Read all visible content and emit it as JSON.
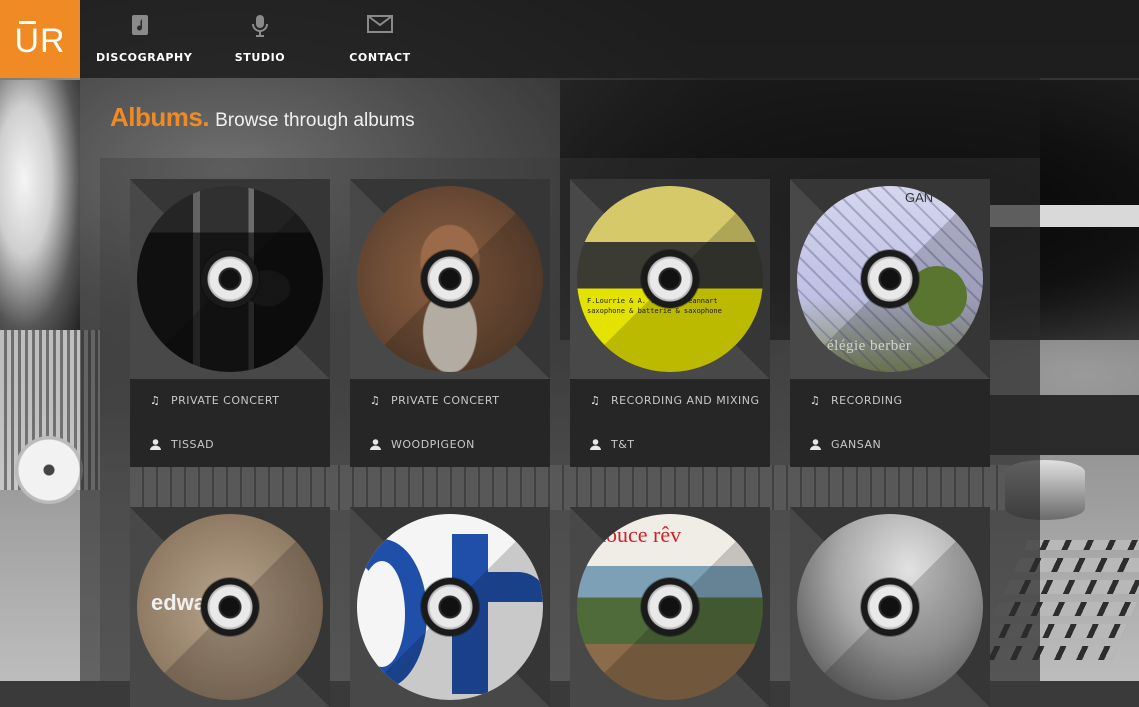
{
  "brand": {
    "logo_text": "UR"
  },
  "nav": {
    "items": [
      {
        "label": "DISCOGRAPHY",
        "icon": "music-note-icon"
      },
      {
        "label": "STUDIO",
        "icon": "microphone-icon"
      },
      {
        "label": "CONTACT",
        "icon": "envelope-icon"
      }
    ]
  },
  "page": {
    "title": "Albums.",
    "subtitle": "Browse through albums"
  },
  "albums": [
    {
      "service": "PRIVATE CONCERT",
      "artist": "TISSAD"
    },
    {
      "service": "PRIVATE CONCERT",
      "artist": "WOODPIGEON"
    },
    {
      "service": "RECORDING AND MIXING",
      "artist": "T&T",
      "cover_text": "F.Lourrie & A. ... & L.Jeannart\nsaxophone & batterie & saxophone"
    },
    {
      "service": "RECORDING",
      "artist": "GANSAN",
      "cover_text_top": "GAN",
      "cover_text_bottom": "élégie berbèr"
    },
    {
      "cover_text": "edwa mes"
    },
    {},
    {
      "cover_text": "douce rêv"
    },
    {}
  ],
  "colors": {
    "accent": "#f08a24",
    "card": "#262626"
  }
}
